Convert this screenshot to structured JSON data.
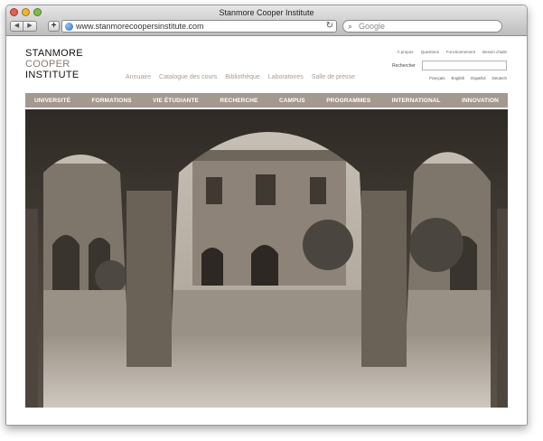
{
  "browser": {
    "window_title": "Stanmore Cooper Institute",
    "nav_back": "◀",
    "nav_forward": "▶",
    "add_tab": "+",
    "url": "www.stanmorecoopersinstitute.com",
    "reload_glyph": "↻",
    "search_placeholder": "Google",
    "search_glyph": "⌕"
  },
  "site": {
    "logo": {
      "line1": "STANMORE",
      "line2": "COOPER",
      "line3": "INSTITUTE"
    },
    "utility_links": [
      "À propos",
      "Questions",
      "Fonctionnement",
      "Besoin d'aide"
    ],
    "search_label": "Rechercher",
    "top_nav": [
      "Annuaire",
      "Catalogue des cours",
      "Bibliothèque",
      "Laboratoires",
      "Salle de presse"
    ],
    "languages": [
      "Français",
      "English",
      "Español",
      "Deutsch"
    ],
    "main_nav": [
      "UNIVERSITÉ",
      "FORMATIONS",
      "VIE ÉTUDIANTE",
      "RECHERCHE",
      "CAMPUS",
      "PROGRAMMES",
      "INTERNATIONAL",
      "INNOVATION"
    ]
  },
  "colors": {
    "nav_bar": "#a4998f",
    "top_nav_text": "#a79c93",
    "logo_accent": "#8a7a6e"
  },
  "hero_image": "sepia photo of a gothic stone cloister courtyard seen through arches"
}
